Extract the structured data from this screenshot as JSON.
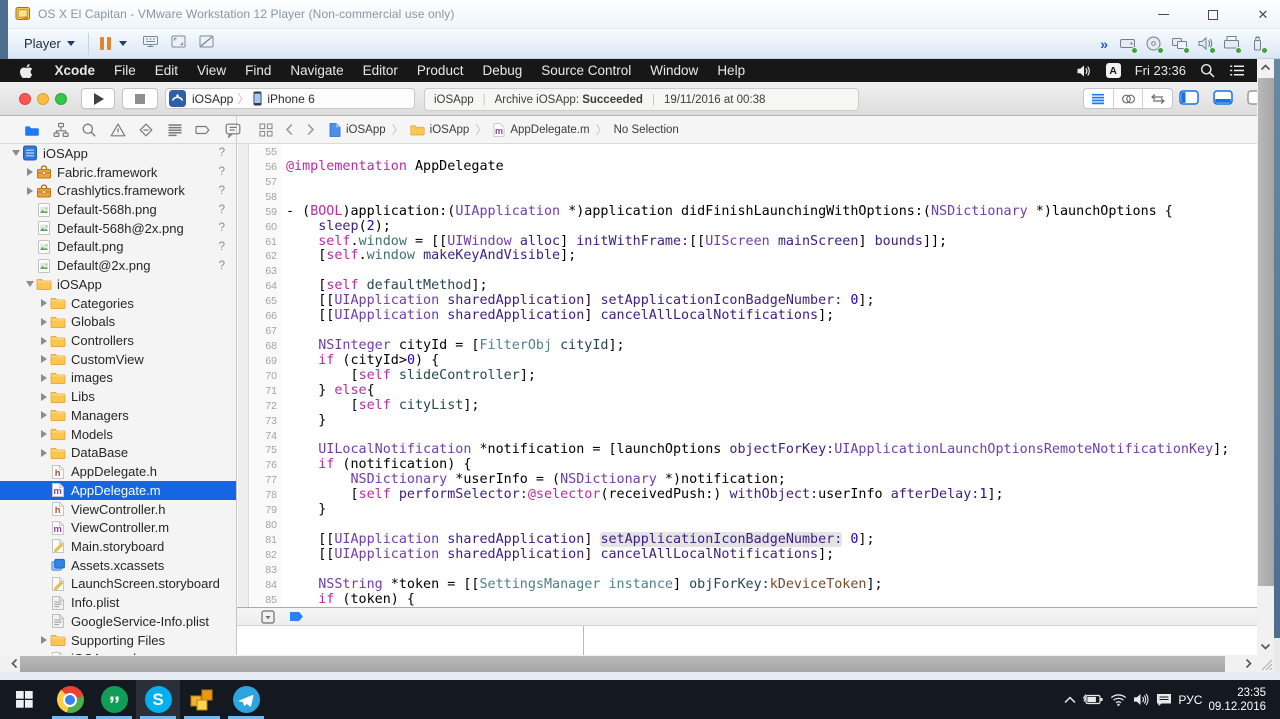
{
  "vmware": {
    "title": "OS X El Capitan - VMware Workstation 12 Player (Non-commercial use only)",
    "player_label": "Player",
    "toolbar_icons": [
      "ctrl-alt-del",
      "fullscreen",
      "unity"
    ],
    "overflow_chevron": "»",
    "device_icons": [
      "hard-disk",
      "cd-rom",
      "network",
      "sound",
      "printer",
      "usb"
    ],
    "window_buttons": [
      "minimize",
      "maximize",
      "close"
    ]
  },
  "menubar": {
    "items": [
      "Xcode",
      "File",
      "Edit",
      "View",
      "Find",
      "Navigate",
      "Editor",
      "Product",
      "Debug",
      "Source Control",
      "Window",
      "Help"
    ],
    "input_badge": "A",
    "clock": "Fri 23:36"
  },
  "xcode_toolbar": {
    "scheme_name": "iOSApp",
    "scheme_device": "iPhone 6",
    "status_project": "iOSApp",
    "status_action": "Archive iOSApp:",
    "status_result": "Succeeded",
    "status_sep": "|",
    "status_date": "19/11/2016 at 00:38"
  },
  "navigator_icons": [
    "project",
    "symbols",
    "search",
    "issues",
    "tests",
    "reports",
    "breakpoints",
    "logs"
  ],
  "jumpbar": {
    "crumbs": [
      {
        "label": "iOSApp",
        "icon": "file-blue"
      },
      {
        "label": "iOSApp",
        "icon": "folder-small"
      },
      {
        "label": "AppDelegate.m",
        "icon": "file-m-small"
      },
      {
        "label": "No Selection",
        "icon": ""
      }
    ],
    "sep": "〉"
  },
  "tree": [
    {
      "label": "iOSApp",
      "icon": "proj",
      "level": 0,
      "dis": "d",
      "badge": "?"
    },
    {
      "label": "Fabric.framework",
      "icon": "fw",
      "level": 1,
      "dis": "r",
      "badge": "?"
    },
    {
      "label": "Crashlytics.framework",
      "icon": "fw",
      "level": 1,
      "dis": "r",
      "badge": "?"
    },
    {
      "label": "Default-568h.png",
      "icon": "img",
      "level": 1,
      "dis": "",
      "badge": "?"
    },
    {
      "label": "Default-568h@2x.png",
      "icon": "img",
      "level": 1,
      "dis": "",
      "badge": "?"
    },
    {
      "label": "Default.png",
      "icon": "img",
      "level": 1,
      "dis": "",
      "badge": "?"
    },
    {
      "label": "Default@2x.png",
      "icon": "img",
      "level": 1,
      "dis": "",
      "badge": "?"
    },
    {
      "label": "iOSApp",
      "icon": "folder",
      "level": 1,
      "dis": "d",
      "badge": ""
    },
    {
      "label": "Categories",
      "icon": "folder",
      "level": 2,
      "dis": "r",
      "badge": ""
    },
    {
      "label": "Globals",
      "icon": "folder",
      "level": 2,
      "dis": "r",
      "badge": ""
    },
    {
      "label": "Controllers",
      "icon": "folder",
      "level": 2,
      "dis": "r",
      "badge": ""
    },
    {
      "label": "CustomView",
      "icon": "folder",
      "level": 2,
      "dis": "r",
      "badge": ""
    },
    {
      "label": "images",
      "icon": "folder",
      "level": 2,
      "dis": "r",
      "badge": ""
    },
    {
      "label": "Libs",
      "icon": "folder",
      "level": 2,
      "dis": "r",
      "badge": ""
    },
    {
      "label": "Managers",
      "icon": "folder",
      "level": 2,
      "dis": "r",
      "badge": ""
    },
    {
      "label": "Models",
      "icon": "folder",
      "level": 2,
      "dis": "r",
      "badge": ""
    },
    {
      "label": "DataBase",
      "icon": "folder",
      "level": 2,
      "dis": "r",
      "badge": ""
    },
    {
      "label": "AppDelegate.h",
      "icon": "fileh",
      "level": 2,
      "dis": "",
      "badge": ""
    },
    {
      "label": "AppDelegate.m",
      "icon": "filem",
      "level": 2,
      "dis": "",
      "badge": "",
      "selected": true
    },
    {
      "label": "ViewController.h",
      "icon": "fileh",
      "level": 2,
      "dis": "",
      "badge": ""
    },
    {
      "label": "ViewController.m",
      "icon": "filem",
      "level": 2,
      "dis": "",
      "badge": ""
    },
    {
      "label": "Main.storyboard",
      "icon": "sb",
      "level": 2,
      "dis": "",
      "badge": ""
    },
    {
      "label": "Assets.xcassets",
      "icon": "assets",
      "level": 2,
      "dis": "",
      "badge": ""
    },
    {
      "label": "LaunchScreen.storyboard",
      "icon": "sb",
      "level": 2,
      "dis": "",
      "badge": ""
    },
    {
      "label": "Info.plist",
      "icon": "plist",
      "level": 2,
      "dis": "",
      "badge": ""
    },
    {
      "label": "GoogleService-Info.plist",
      "icon": "plist",
      "level": 2,
      "dis": "",
      "badge": ""
    },
    {
      "label": "Supporting Files",
      "icon": "folder",
      "level": 2,
      "dis": "r",
      "badge": ""
    },
    {
      "label": "iOSApp.pch",
      "icon": "fileh",
      "level": 2,
      "dis": "",
      "badge": ""
    }
  ],
  "editor": {
    "lines": [
      {
        "n": "55",
        "tk": []
      },
      {
        "n": "56",
        "tk": [
          [
            "@implementation",
            "k"
          ],
          [
            " AppDelegate",
            "p"
          ]
        ]
      },
      {
        "n": "57",
        "tk": []
      },
      {
        "n": "58",
        "tk": []
      },
      {
        "n": "59",
        "tk": [
          [
            "- (",
            "p"
          ],
          [
            "BOOL",
            "k"
          ],
          [
            ")application:(",
            "p"
          ],
          [
            "UIApplication",
            "c"
          ],
          [
            " *)application didFinishLaunchingWithOptions:(",
            "p"
          ],
          [
            "NSDictionary",
            "c"
          ],
          [
            " *)launchOptions {",
            "p"
          ]
        ]
      },
      {
        "n": "60",
        "tk": [
          [
            "    ",
            "p"
          ],
          [
            "sleep",
            "f"
          ],
          [
            "(",
            "p"
          ],
          [
            "2",
            "n"
          ],
          [
            ");",
            "p"
          ]
        ]
      },
      {
        "n": "61",
        "tk": [
          [
            "    ",
            "p"
          ],
          [
            "self",
            "k"
          ],
          [
            ".",
            "p"
          ],
          [
            "window",
            "P"
          ],
          [
            " = [[",
            "p"
          ],
          [
            "UIWindow",
            "c"
          ],
          [
            " ",
            "p"
          ],
          [
            "alloc",
            "f"
          ],
          [
            "] ",
            "p"
          ],
          [
            "initWithFrame:",
            "f"
          ],
          [
            "[[",
            "p"
          ],
          [
            "UIScreen",
            "c"
          ],
          [
            " ",
            "p"
          ],
          [
            "mainScreen",
            "f"
          ],
          [
            "] ",
            "p"
          ],
          [
            "bounds",
            "f"
          ],
          [
            "]];",
            "p"
          ]
        ]
      },
      {
        "n": "62",
        "tk": [
          [
            "    [",
            "p"
          ],
          [
            "self",
            "k"
          ],
          [
            ".",
            "p"
          ],
          [
            "window",
            "P"
          ],
          [
            " ",
            "p"
          ],
          [
            "makeKeyAndVisible",
            "f"
          ],
          [
            "];",
            "p"
          ]
        ]
      },
      {
        "n": "63",
        "tk": []
      },
      {
        "n": "64",
        "tk": [
          [
            "    [",
            "p"
          ],
          [
            "self",
            "k"
          ],
          [
            " ",
            "p"
          ],
          [
            "defaultMethod",
            "m"
          ],
          [
            "];",
            "p"
          ]
        ]
      },
      {
        "n": "65",
        "tk": [
          [
            "    [[",
            "p"
          ],
          [
            "UIApplication",
            "c"
          ],
          [
            " ",
            "p"
          ],
          [
            "sharedApplication",
            "f"
          ],
          [
            "] ",
            "p"
          ],
          [
            "setApplicationIconBadgeNumber:",
            "f"
          ],
          [
            " ",
            "p"
          ],
          [
            "0",
            "n"
          ],
          [
            "];",
            "p"
          ]
        ]
      },
      {
        "n": "66",
        "tk": [
          [
            "    [[",
            "p"
          ],
          [
            "UIApplication",
            "c"
          ],
          [
            " ",
            "p"
          ],
          [
            "sharedApplication",
            "f"
          ],
          [
            "] ",
            "p"
          ],
          [
            "cancelAllLocalNotifications",
            "f"
          ],
          [
            "];",
            "p"
          ]
        ]
      },
      {
        "n": "67",
        "tk": []
      },
      {
        "n": "68",
        "tk": [
          [
            "    ",
            "p"
          ],
          [
            "NSInteger",
            "c"
          ],
          [
            " cityId = [",
            "p"
          ],
          [
            "FilterObj",
            "C"
          ],
          [
            " ",
            "p"
          ],
          [
            "cityId",
            "m"
          ],
          [
            "];",
            "p"
          ]
        ]
      },
      {
        "n": "69",
        "tk": [
          [
            "    ",
            "p"
          ],
          [
            "if",
            "k"
          ],
          [
            " (cityId>",
            "p"
          ],
          [
            "0",
            "n"
          ],
          [
            ") {",
            "p"
          ]
        ]
      },
      {
        "n": "70",
        "tk": [
          [
            "        [",
            "p"
          ],
          [
            "self",
            "k"
          ],
          [
            " ",
            "p"
          ],
          [
            "slideController",
            "m"
          ],
          [
            "];",
            "p"
          ]
        ]
      },
      {
        "n": "71",
        "tk": [
          [
            "    } ",
            "p"
          ],
          [
            "else",
            "k"
          ],
          [
            "{",
            "p"
          ]
        ]
      },
      {
        "n": "72",
        "tk": [
          [
            "        [",
            "p"
          ],
          [
            "self",
            "k"
          ],
          [
            " ",
            "p"
          ],
          [
            "cityList",
            "m"
          ],
          [
            "];",
            "p"
          ]
        ]
      },
      {
        "n": "73",
        "tk": [
          [
            "    }",
            "p"
          ]
        ]
      },
      {
        "n": "74",
        "tk": []
      },
      {
        "n": "75",
        "tk": [
          [
            "    ",
            "p"
          ],
          [
            "UILocalNotification",
            "c"
          ],
          [
            " *notification = [launchOptions ",
            "p"
          ],
          [
            "objectForKey:",
            "f"
          ],
          [
            "UIApplicationLaunchOptionsRemoteNotificationKey",
            "c"
          ],
          [
            "];",
            "p"
          ]
        ]
      },
      {
        "n": "76",
        "tk": [
          [
            "    ",
            "p"
          ],
          [
            "if",
            "k"
          ],
          [
            " (notification) {",
            "p"
          ]
        ]
      },
      {
        "n": "77",
        "tk": [
          [
            "        ",
            "p"
          ],
          [
            "NSDictionary",
            "c"
          ],
          [
            " *userInfo = (",
            "p"
          ],
          [
            "NSDictionary",
            "c"
          ],
          [
            " *)notification;",
            "p"
          ]
        ]
      },
      {
        "n": "78",
        "tk": [
          [
            "        [",
            "p"
          ],
          [
            "self",
            "k"
          ],
          [
            " ",
            "p"
          ],
          [
            "performSelector:",
            "f"
          ],
          [
            "@selector",
            "k"
          ],
          [
            "(receivedPush:) ",
            "p"
          ],
          [
            "withObject:",
            "f"
          ],
          [
            "userInfo ",
            "p"
          ],
          [
            "afterDelay:",
            "f"
          ],
          [
            "1",
            "n"
          ],
          [
            "];",
            "p"
          ]
        ]
      },
      {
        "n": "79",
        "tk": [
          [
            "    }",
            "p"
          ]
        ]
      },
      {
        "n": "80",
        "tk": []
      },
      {
        "n": "81",
        "tk": [
          [
            "    [[",
            "p"
          ],
          [
            "UIApplication",
            "c"
          ],
          [
            " ",
            "p"
          ],
          [
            "sharedApplication",
            "f"
          ],
          [
            "] ",
            "p"
          ],
          [
            "setApplicationIconBadgeNumber:",
            "f",
            1
          ],
          [
            " ",
            "p"
          ],
          [
            "0",
            "n"
          ],
          [
            "];",
            "p"
          ]
        ]
      },
      {
        "n": "82",
        "tk": [
          [
            "    [[",
            "p"
          ],
          [
            "UIApplication",
            "c"
          ],
          [
            " ",
            "p"
          ],
          [
            "sharedApplication",
            "f"
          ],
          [
            "] ",
            "p"
          ],
          [
            "cancelAllLocalNotifications",
            "f"
          ],
          [
            "];",
            "p"
          ]
        ]
      },
      {
        "n": "83",
        "tk": []
      },
      {
        "n": "84",
        "tk": [
          [
            "    ",
            "p"
          ],
          [
            "NSString",
            "c"
          ],
          [
            " *token = [[",
            "p"
          ],
          [
            "SettingsManager",
            "C"
          ],
          [
            " ",
            "p"
          ],
          [
            "instance",
            "C"
          ],
          [
            "] ",
            "p"
          ],
          [
            "objForKey:",
            "m"
          ],
          [
            "kDeviceToken",
            "d"
          ],
          [
            "];",
            "p"
          ]
        ]
      },
      {
        "n": "85",
        "tk": [
          [
            "    ",
            "p"
          ],
          [
            "if",
            "k"
          ],
          [
            " (token) {",
            "p"
          ]
        ]
      }
    ]
  },
  "taskbar": {
    "apps": [
      {
        "name": "chrome",
        "active": false
      },
      {
        "name": "hangouts",
        "active": false
      },
      {
        "name": "skype",
        "active": true
      },
      {
        "name": "vmware",
        "active": false
      },
      {
        "name": "telegram",
        "active": false
      }
    ],
    "tray_lang": "РУС",
    "tray_time": "23:35",
    "tray_date": "09.12.2016"
  }
}
